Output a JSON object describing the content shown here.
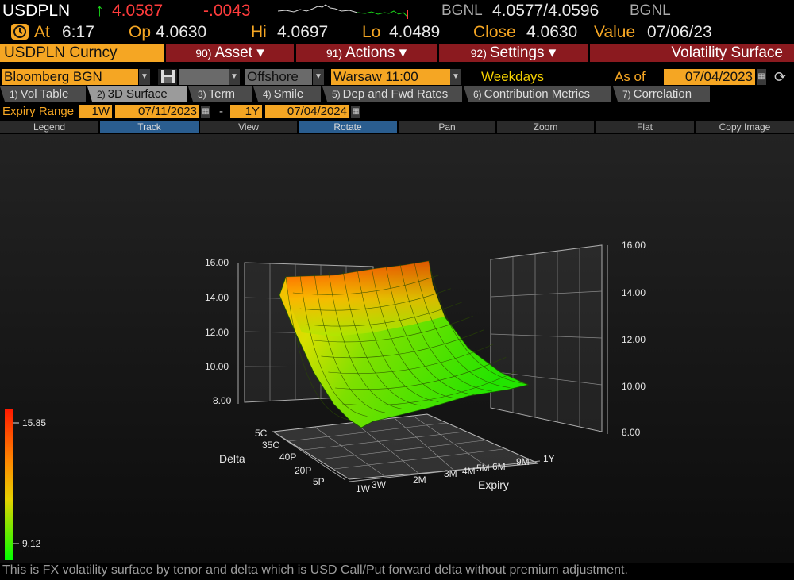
{
  "quote": {
    "ticker": "USDPLN",
    "arrow": "↑",
    "last": "4.0587",
    "change": "-.0043",
    "source_left": "BGNL",
    "bid_ask": "4.0577/4.0596",
    "source_right": "BGNL",
    "at_label": "At",
    "at_time": "6:17",
    "open_label": "Op",
    "open": "4.0630",
    "high_label": "Hi",
    "high": "4.0697",
    "low_label": "Lo",
    "low": "4.0489",
    "close_label": "Close",
    "close": "4.0630",
    "value_label": "Value",
    "value_date": "07/06/23"
  },
  "menu": {
    "security": "USDPLN Curncy",
    "items": [
      {
        "num": "90)",
        "label": "Asset ▾"
      },
      {
        "num": "91)",
        "label": "Actions ▾"
      },
      {
        "num": "92)",
        "label": "Settings ▾"
      }
    ],
    "title": "Volatility Surface"
  },
  "controls": {
    "source": "Bloomberg BGN",
    "market": "Offshore",
    "location": "Warsaw 11:00",
    "days": "Weekdays",
    "as_of_label": "As of",
    "as_of": "07/04/2023"
  },
  "tabs": [
    {
      "num": "1)",
      "label": "Vol Table"
    },
    {
      "num": "2)",
      "label": "3D Surface"
    },
    {
      "num": "3)",
      "label": "Term"
    },
    {
      "num": "4)",
      "label": "Smile"
    },
    {
      "num": "5)",
      "label": "Dep and Fwd Rates"
    },
    {
      "num": "6)",
      "label": "Contribution Metrics"
    },
    {
      "num": "7)",
      "label": "Correlation"
    }
  ],
  "expiry": {
    "label": "Expiry Range",
    "from_tenor": "1W",
    "from_date": "07/11/2023",
    "dash": "-",
    "to_tenor": "1Y",
    "to_date": "07/04/2024"
  },
  "toolbar": [
    "Legend",
    "Track",
    "View",
    "Rotate",
    "Pan",
    "Zoom",
    "Flat",
    "Copy Image"
  ],
  "chart_data": {
    "type": "surface",
    "axes": {
      "delta_label": "Delta",
      "expiry_label": "Expiry",
      "delta_ticks": [
        "5C",
        "35C",
        "40P",
        "20P",
        "5P"
      ],
      "expiry_ticks": [
        "1W",
        "3W",
        "2M",
        "3M",
        "4M",
        "5M",
        "6M",
        "9M",
        "1Y"
      ],
      "z_left_ticks": [
        "16.00",
        "14.00",
        "12.00",
        "10.00",
        "8.00"
      ],
      "z_right_ticks": [
        "16.00",
        "14.00",
        "12.00",
        "10.00",
        "8.00"
      ],
      "zlim": [
        8,
        16
      ]
    },
    "color_scale": {
      "max": "15.85",
      "min": "9.12",
      "max_color": "#ff1a00",
      "min_color": "#00ff00"
    }
  },
  "footer": "This is FX volatility surface by tenor and delta which is USD Call/Put forward delta without premium adjustment."
}
